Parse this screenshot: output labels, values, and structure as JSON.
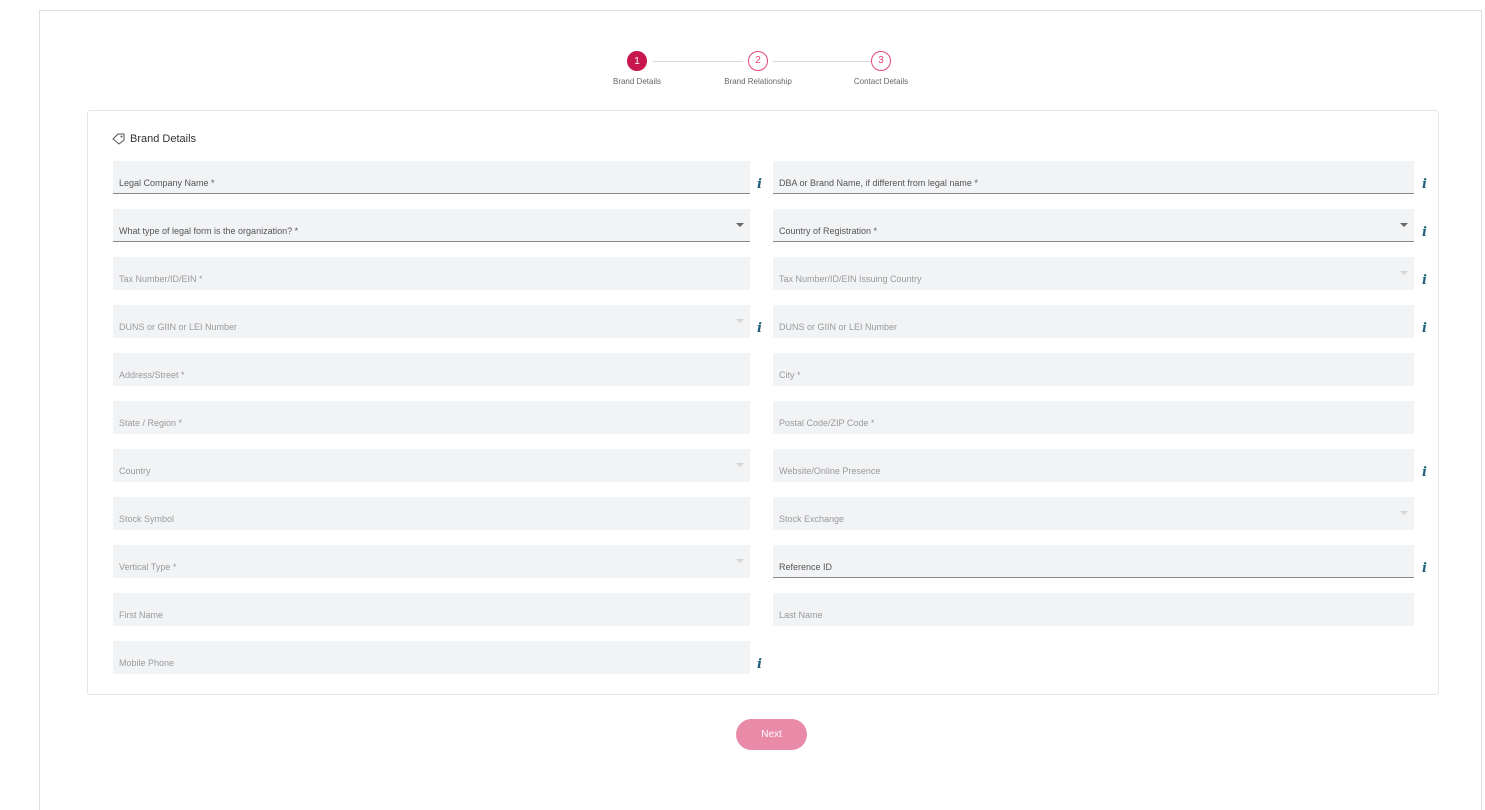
{
  "stepper": {
    "steps": [
      {
        "number": "1",
        "label": "Brand Details"
      },
      {
        "number": "2",
        "label": "Brand Relationship"
      },
      {
        "number": "3",
        "label": "Contact Details"
      }
    ],
    "active_step": 1,
    "colors": {
      "active": "#c8174c",
      "pending": "#e8457a"
    }
  },
  "panel": {
    "title": "Brand Details",
    "title_icon": "tag-icon"
  },
  "form": {
    "left": [
      {
        "placeholder": "Legal Company Name *",
        "underline": true,
        "dropdown": false,
        "info": true
      },
      {
        "placeholder": "What type of legal form is the organization? *",
        "underline": true,
        "dropdown": true,
        "info": false
      },
      {
        "placeholder": "Tax Number/ID/EIN *",
        "underline": false,
        "dropdown": false,
        "info": false
      },
      {
        "placeholder": "DUNS or GIIN or LEI Number",
        "underline": false,
        "dropdown": true,
        "info": true
      },
      {
        "placeholder": "Address/Street *",
        "underline": false,
        "dropdown": false,
        "info": false
      },
      {
        "placeholder": "State / Region *",
        "underline": false,
        "dropdown": false,
        "info": false
      },
      {
        "placeholder": "Country",
        "underline": false,
        "dropdown": true,
        "info": false
      },
      {
        "placeholder": "Stock Symbol",
        "underline": false,
        "dropdown": false,
        "info": false
      },
      {
        "placeholder": "Vertical Type *",
        "underline": false,
        "dropdown": true,
        "info": false
      },
      {
        "placeholder": "First Name",
        "underline": false,
        "dropdown": false,
        "info": false
      },
      {
        "placeholder": "Mobile Phone",
        "underline": false,
        "dropdown": false,
        "info": true
      }
    ],
    "right": [
      {
        "placeholder": "DBA or Brand Name, if different from legal name *",
        "underline": true,
        "dropdown": false,
        "info": true
      },
      {
        "placeholder": "Country of Registration *",
        "underline": true,
        "dropdown": true,
        "info": true
      },
      {
        "placeholder": "Tax Number/ID/EIN Issuing Country",
        "underline": false,
        "dropdown": true,
        "info": true
      },
      {
        "placeholder": "DUNS or GIIN or LEI Number",
        "underline": false,
        "dropdown": false,
        "info": true
      },
      {
        "placeholder": "City *",
        "underline": false,
        "dropdown": false,
        "info": false
      },
      {
        "placeholder": "Postal Code/ZIP Code *",
        "underline": false,
        "dropdown": false,
        "info": false
      },
      {
        "placeholder": "Website/Online Presence",
        "underline": false,
        "dropdown": false,
        "info": true
      },
      {
        "placeholder": "Stock Exchange",
        "underline": false,
        "dropdown": true,
        "info": false
      },
      {
        "placeholder": "Reference ID",
        "underline": true,
        "dropdown": false,
        "info": true
      },
      {
        "placeholder": "Last Name",
        "underline": false,
        "dropdown": false,
        "info": false
      }
    ]
  },
  "actions": {
    "next_label": "Next",
    "next_color": "#e98aa8"
  }
}
